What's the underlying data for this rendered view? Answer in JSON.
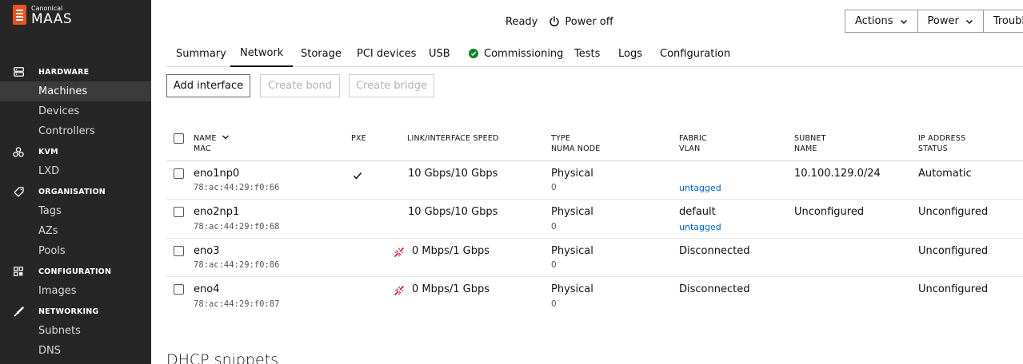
{
  "sidebar": {
    "logo_sub": "Canonical",
    "logo_main": "MAAS",
    "sections": [
      {
        "label": "HARDWARE",
        "icon": "server-icon",
        "items": [
          "Machines",
          "Devices",
          "Controllers"
        ]
      },
      {
        "label": "KVM",
        "icon": "kvm-cluster-icon",
        "items": [
          "LXD"
        ]
      },
      {
        "label": "ORGANISATION",
        "icon": "tag-icon",
        "items": [
          "Tags",
          "AZs",
          "Pools"
        ]
      },
      {
        "label": "CONFIGURATION",
        "icon": "config-grid-icon",
        "items": [
          "Images"
        ]
      },
      {
        "label": "NETWORKING",
        "icon": "network-link-icon",
        "items": [
          "Subnets",
          "DNS"
        ]
      }
    ],
    "active_item": "Machines"
  },
  "header": {
    "status": "Ready",
    "power_state": "Power off",
    "buttons": [
      "Actions",
      "Power",
      "Troubles"
    ]
  },
  "tabs": [
    {
      "label": "Summary"
    },
    {
      "label": "Network",
      "active": true
    },
    {
      "label": "Storage"
    },
    {
      "label": "PCI devices"
    },
    {
      "label": "USB"
    },
    {
      "label": "Commissioning",
      "status": "passed"
    },
    {
      "label": "Tests"
    },
    {
      "label": "Logs"
    },
    {
      "label": "Configuration"
    }
  ],
  "actions": {
    "add_interface": "Add interface",
    "create_bond": "Create bond",
    "create_bridge": "Create bridge"
  },
  "table": {
    "headers": {
      "name": "NAME",
      "mac": "MAC",
      "pxe": "PXE",
      "speed": "LINK/INTERFACE SPEED",
      "type": "TYPE",
      "numa": "NUMA NODE",
      "fabric": "FABRIC",
      "vlan": "VLAN",
      "subnet": "SUBNET",
      "subnet_name": "NAME",
      "ip": "IP ADDRESS",
      "status": "STATUS"
    },
    "rows": [
      {
        "name": "eno1np0",
        "mac": "78:ac:44:29:f0:66",
        "pxe": true,
        "speed": "10 Gbps/10 Gbps",
        "disconnected": false,
        "type": "Physical",
        "numa": "0",
        "fabric": "",
        "vlan": "untagged",
        "subnet": "10.100.129.0/24",
        "ip": "Automatic"
      },
      {
        "name": "eno2np1",
        "mac": "78:ac:44:29:f0:68",
        "pxe": false,
        "speed": "10 Gbps/10 Gbps",
        "disconnected": false,
        "type": "Physical",
        "numa": "0",
        "fabric": "default",
        "vlan": "untagged",
        "subnet": "Unconfigured",
        "ip": "Unconfigured"
      },
      {
        "name": "eno3",
        "mac": "78:ac:44:29:f0:86",
        "pxe": false,
        "speed": "0 Mbps/1 Gbps",
        "disconnected": true,
        "type": "Physical",
        "numa": "0",
        "fabric": "Disconnected",
        "vlan": "",
        "subnet": "",
        "ip": "Unconfigured"
      },
      {
        "name": "eno4",
        "mac": "78:ac:44:29:f0:87",
        "pxe": false,
        "speed": "0 Mbps/1 Gbps",
        "disconnected": true,
        "type": "Physical",
        "numa": "0",
        "fabric": "Disconnected",
        "vlan": "",
        "subnet": "",
        "ip": "Unconfigured"
      }
    ]
  },
  "dhcp_title": "DHCP snippets",
  "colors": {
    "sidebar_bg": "#262626",
    "brand_orange": "#e95420",
    "success_green": "#0e8420",
    "link_blue": "#0066cc",
    "disconnect_red": "#c7162b"
  }
}
